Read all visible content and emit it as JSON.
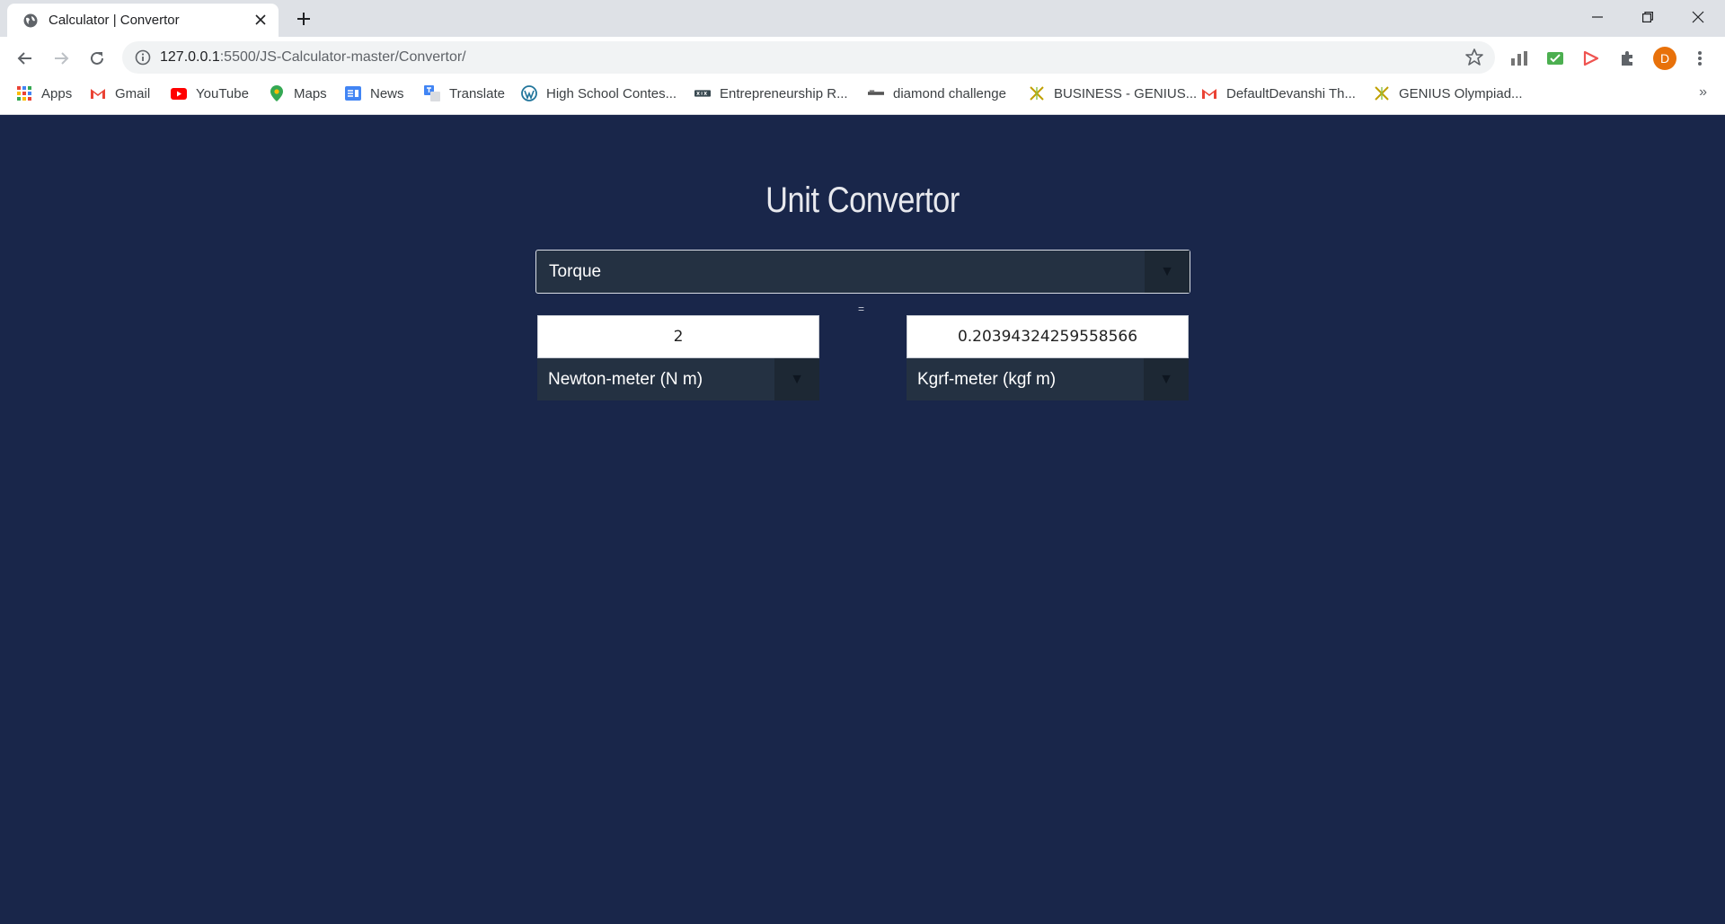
{
  "browser": {
    "tab_title": "Calculator | Convertor",
    "url_host": "127.0.0.1",
    "url_rest": ":5500/JS-Calculator-master/Convertor/",
    "avatar_letter": "D",
    "bookmarks": [
      "Apps",
      "Gmail",
      "YouTube",
      "Maps",
      "News",
      "Translate",
      "High School Contes...",
      "Entrepreneurship R...",
      "diamond challenge",
      "BUSINESS - GENIUS...",
      "DefaultDevanshi Th...",
      "GENIUS Olympiad..."
    ],
    "bookmarks_more": "»"
  },
  "converter": {
    "title": "Unit Convertor",
    "category": "Torque",
    "equals": "=",
    "from_value": "2",
    "from_unit": "Newton-meter (N m)",
    "to_value": "0.20394324259558566",
    "to_unit": "Kgrf-meter (kgf m)",
    "dropdown_arrow": "▼"
  },
  "colors": {
    "page_bg": "#19264a",
    "select_bg": "#243142",
    "title": "#e8e9ee"
  }
}
